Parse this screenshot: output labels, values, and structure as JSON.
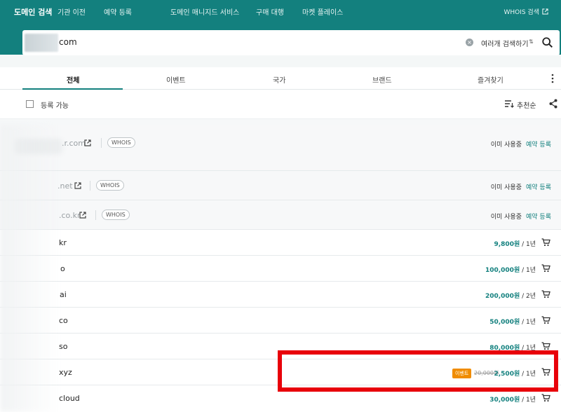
{
  "nav": {
    "brand": "도메인 검색",
    "items": [
      "기관 이전",
      "예약 등록",
      "도메인 매니지드 서비스",
      "구매 대행",
      "마켓 플레이스"
    ],
    "whois": "WHOIS 검색"
  },
  "search": {
    "value": "com",
    "multi_label": "여러개 검색하기",
    "multi_icon": "⇅"
  },
  "tabs": [
    "전체",
    "이벤트",
    "국가",
    "브랜드",
    "즐겨찾기"
  ],
  "filter": {
    "checkbox_label": "등록 가능",
    "sort_label": "추천순"
  },
  "rows": [
    {
      "name": ".r.com",
      "whois": "WHOIS",
      "status": "이미 사용중",
      "action": "예약 등록"
    },
    {
      "name": ".net",
      "whois": "WHOIS",
      "status": "이미 사용중",
      "action": "예약 등록"
    },
    {
      "name": ".co.kr",
      "whois": "WHOIS",
      "status": "이미 사용중",
      "action": "예약 등록"
    },
    {
      "name": "kr",
      "price": "9,800원",
      "period": " / 1년"
    },
    {
      "name": "o",
      "price": "100,000원",
      "period": " / 1년"
    },
    {
      "name": "ai",
      "price": "200,000원",
      "period": " / 2년"
    },
    {
      "name": "co",
      "price": "50,000원",
      "period": " / 1년"
    },
    {
      "name": "so",
      "price": "80,000원",
      "period": " / 1년"
    },
    {
      "name": "xyz",
      "badge": "이벤트",
      "original": "20,000원",
      "price": "2,500원",
      "period": " / 1년"
    },
    {
      "name": "cloud",
      "price": "30,000원",
      "period": " / 1년"
    }
  ],
  "colors": {
    "accent": "#13807e",
    "event": "#f08c00",
    "highlight": "#e8000a"
  }
}
